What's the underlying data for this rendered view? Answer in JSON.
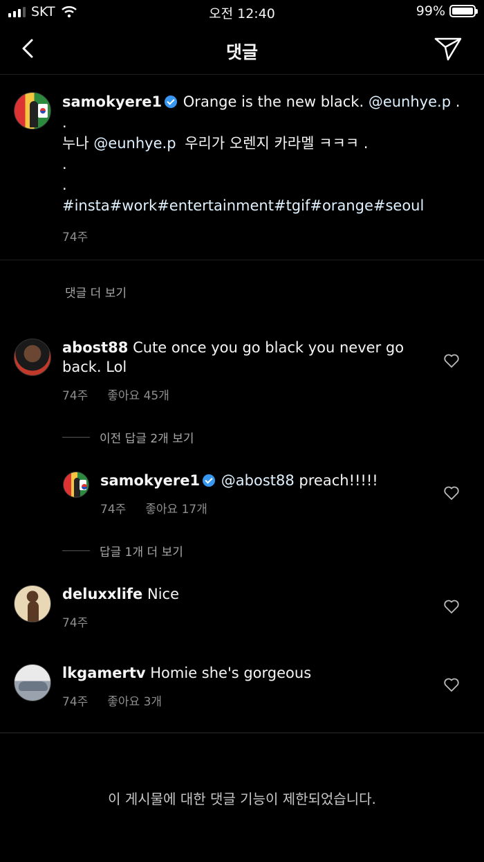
{
  "status_bar": {
    "carrier": "SKT",
    "time": "오전 12:40",
    "battery": "99%",
    "battery_level": 0.99
  },
  "nav": {
    "title": "댓글"
  },
  "caption": {
    "username": "samokyere1",
    "line1_text": "Orange is the new black.",
    "line1_mention": "@eunhye.p",
    "line1_end": ".",
    "line2": ".",
    "line3_pre": "누나",
    "line3_mention": "@eunhye.p",
    "line3_post": "우리가 오렌지 카라멜 ㅋㅋㅋ .",
    "line4": ".",
    "line5": ".",
    "hashtags": "#insta#work#entertainment#tgif#orange#seoul",
    "time": "74주"
  },
  "view_more_comments": "댓글 더 보기",
  "comments": [
    {
      "username": "abost88",
      "text": "Cute once you go black you never go back. Lol",
      "time": "74주",
      "likes": "좋아요 45개"
    },
    {
      "username": "deluxxlife",
      "text": "Nice",
      "time": "74주"
    },
    {
      "username": "lkgamertv",
      "text": "Homie she's gorgeous",
      "time": "74주",
      "likes": "좋아요 3개"
    }
  ],
  "previous_replies": "이전 답글 2개 보기",
  "reply": {
    "username": "samokyere1",
    "mention": "@abost88",
    "text": "preach!!!!!",
    "time": "74주",
    "likes": "좋아요 17개"
  },
  "more_replies": "답글 1개 더 보기",
  "restricted_notice": "이 게시물에 대한 댓글 기능이 제한되었습니다.",
  "colors": {
    "background": "#000000",
    "verified": "#3897f0",
    "secondary_text": "#8e8e8e"
  }
}
